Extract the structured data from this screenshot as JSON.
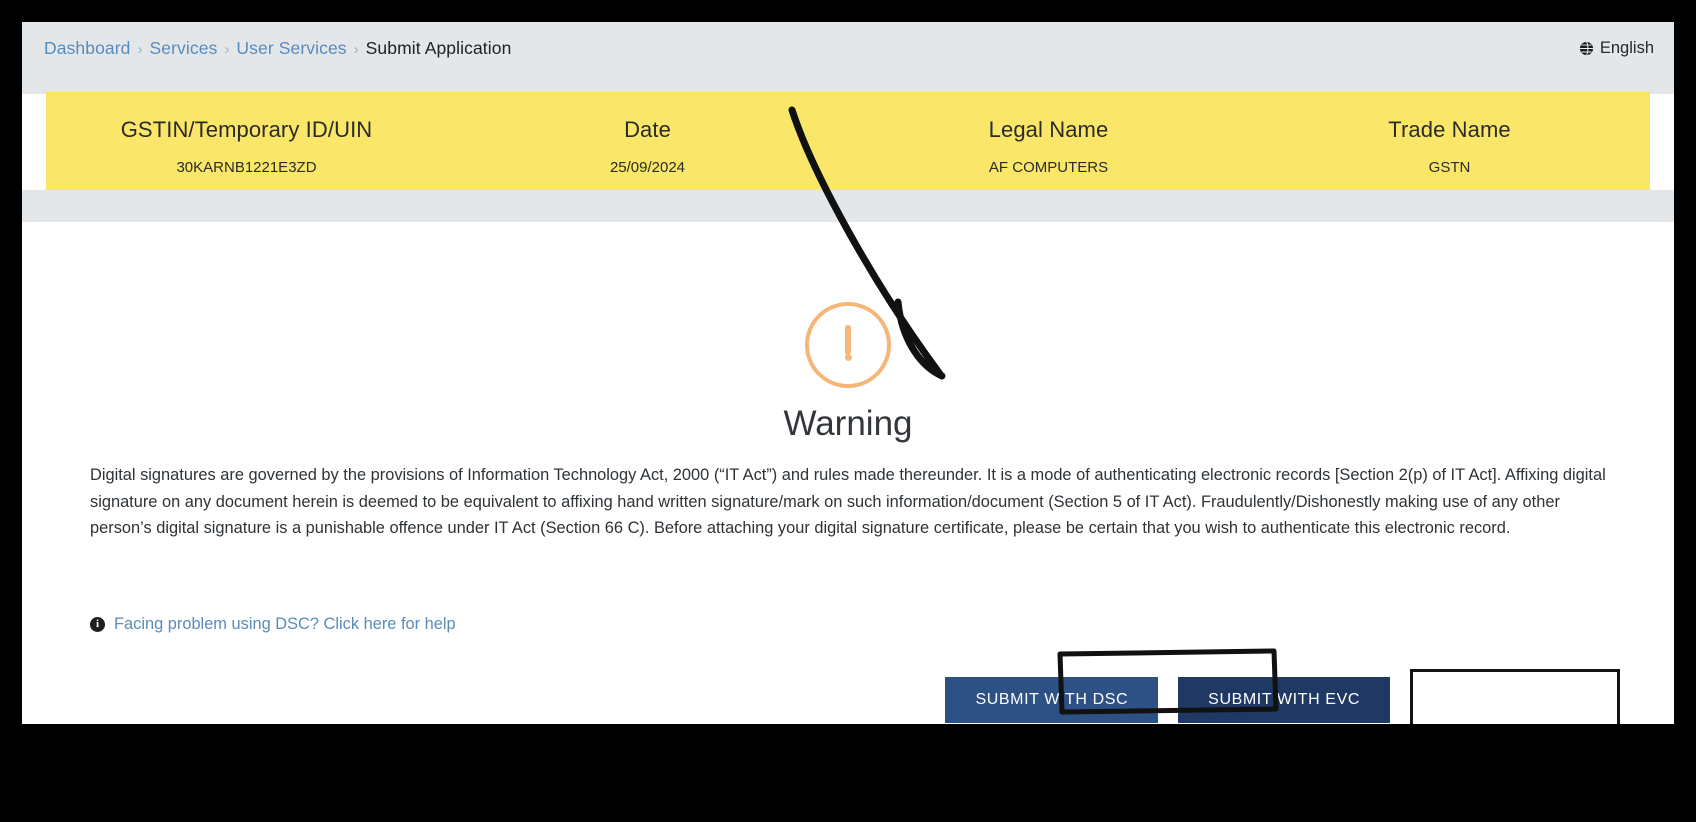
{
  "breadcrumb": {
    "items": [
      {
        "label": "Dashboard",
        "active": false
      },
      {
        "label": "Services",
        "active": false
      },
      {
        "label": "User Services",
        "active": false
      },
      {
        "label": "Submit Application",
        "active": true
      }
    ],
    "separator": "›"
  },
  "language": {
    "label": "English",
    "icon": "globe-icon"
  },
  "taxpayer_band": {
    "background_color": "#fae668",
    "columns": [
      {
        "header": "GSTIN/Temporary ID/UIN",
        "value": "30KARNB1221E3ZD"
      },
      {
        "header": "Date",
        "value": "25/09/2024"
      },
      {
        "header": "Legal Name",
        "value": "AF COMPUTERS"
      },
      {
        "header": "Trade Name",
        "value": "GSTN"
      }
    ]
  },
  "warning": {
    "icon": "exclamation-circle-icon",
    "icon_color": "#f5b678",
    "title": "Warning",
    "body": "Digital signatures are governed by the provisions of Information Technology Act, 2000 (“IT Act”) and rules made thereunder. It is a mode of authenticating electronic records [Section 2(p) of IT Act]. Affixing digital signature on any document herein is deemed to be equivalent to affixing hand written signature/mark on such information/document (Section 5 of IT Act). Fraudulently/Dishonestly making use of any other person’s digital signature is a punishable offence under IT Act (Section 66 C). Before attaching your digital signature certificate, please be certain that you wish to authenticate this electronic record."
  },
  "help_link": {
    "icon": "info-icon",
    "label": "Facing problem using DSC? Click here for help",
    "color": "#5a8bbd"
  },
  "actions": {
    "submit_dsc": {
      "label": "SUBMIT WITH DSC",
      "color": "#2d5184"
    },
    "submit_evc": {
      "label": "SUBMIT WITH EVC",
      "color": "#1f3864"
    },
    "blank_box": {
      "label": ""
    }
  },
  "annotations": {
    "arrow": "hand-drawn-arrow-pointing-down-right",
    "highlight_box": "hand-drawn-box-around-submit-with-evc",
    "ink_color": "#111111"
  }
}
